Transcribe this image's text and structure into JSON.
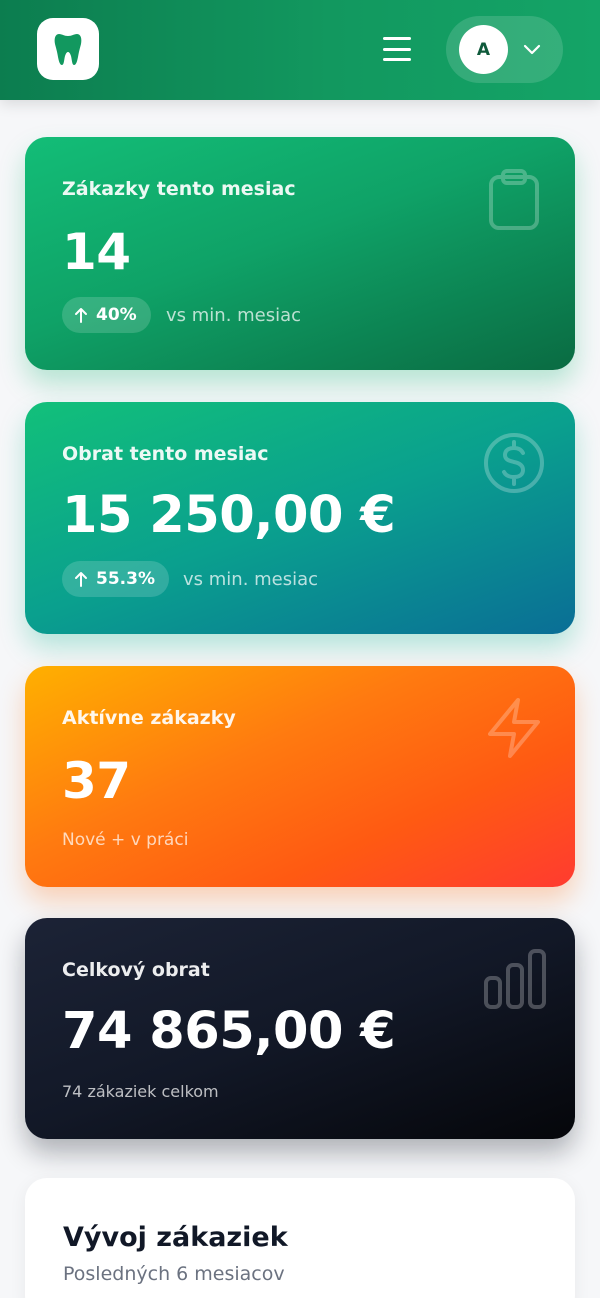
{
  "header": {
    "user_initial": "A",
    "icons": {
      "logo": "tooth-icon",
      "menu": "hamburger-menu-icon",
      "dropdown": "chevron-down-icon"
    }
  },
  "stats": {
    "orders": {
      "label": "Zákazky tento mesiac",
      "value": "14",
      "trend": "40%",
      "trend_note": "vs min. mesiac",
      "icon": "clipboard-icon"
    },
    "revenue": {
      "label": "Obrat tento mesiac",
      "value": "15 250,00 €",
      "trend": "55.3%",
      "trend_note": "vs min. mesiac",
      "icon": "dollar-circle-icon"
    },
    "active": {
      "label": "Aktívne zákazky",
      "value": "37",
      "sub": "Nové + v práci",
      "icon": "lightning-icon"
    },
    "total": {
      "label": "Celkový obrat",
      "value": "74 865,00 €",
      "sub": "74 zákaziek celkom",
      "icon": "bar-chart-icon"
    }
  },
  "orders_trend": {
    "title": "Vývoj zákaziek",
    "subtitle": "Posledných 6 mesiacov"
  },
  "colors": {
    "brand_green": "#12985f",
    "orders_gradient": [
      "#13bd77",
      "#0a6b42"
    ],
    "revenue_gradient": [
      "#12c07a",
      "#0a6e96"
    ],
    "active_gradient": [
      "#ffb000",
      "#ff3b30"
    ],
    "total_gradient": [
      "#1c2336",
      "#05060a"
    ]
  }
}
